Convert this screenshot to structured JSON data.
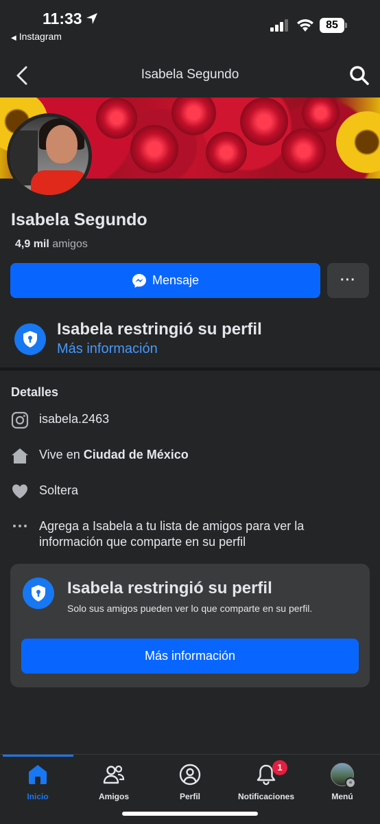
{
  "status_bar": {
    "time": "11:33",
    "back_app": "Instagram",
    "battery": "85"
  },
  "header": {
    "title": "Isabela Segundo"
  },
  "profile": {
    "name": "Isabela Segundo",
    "friends_count": "4,9 mil",
    "friends_label": "amigos",
    "message_button": "Mensaje",
    "more_button": "···"
  },
  "restriction_banner": {
    "title": "Isabela restringió su perfil",
    "link": "Más información"
  },
  "details": {
    "heading": "Detalles",
    "instagram": "isabela.2463",
    "lives_prefix": "Vive en",
    "lives_city": "Ciudad de México",
    "relationship": "Soltera",
    "more_info_line1": "Agrega a Isabela a tu lista de amigos para ver la",
    "more_info_line2": "información que comparte en su perfil"
  },
  "restriction_card": {
    "title": "Isabela restringió su perfil",
    "subtitle": "Solo sus amigos pueden ver lo que comparte en su perfil.",
    "button": "Más información"
  },
  "bottom_nav": {
    "items": [
      {
        "label": "Inicio",
        "icon": "home-icon",
        "active": true
      },
      {
        "label": "Amigos",
        "icon": "friends-icon",
        "active": false
      },
      {
        "label": "Perfil",
        "icon": "profile-icon",
        "active": false
      },
      {
        "label": "Notificaciones",
        "icon": "bell-icon",
        "active": false,
        "badge": "1"
      },
      {
        "label": "Menú",
        "icon": "menu-avatar-icon",
        "active": false
      }
    ]
  },
  "colors": {
    "background": "#242526",
    "accent": "#0866ff",
    "link": "#4599ff",
    "badge": "#e41e3f"
  }
}
